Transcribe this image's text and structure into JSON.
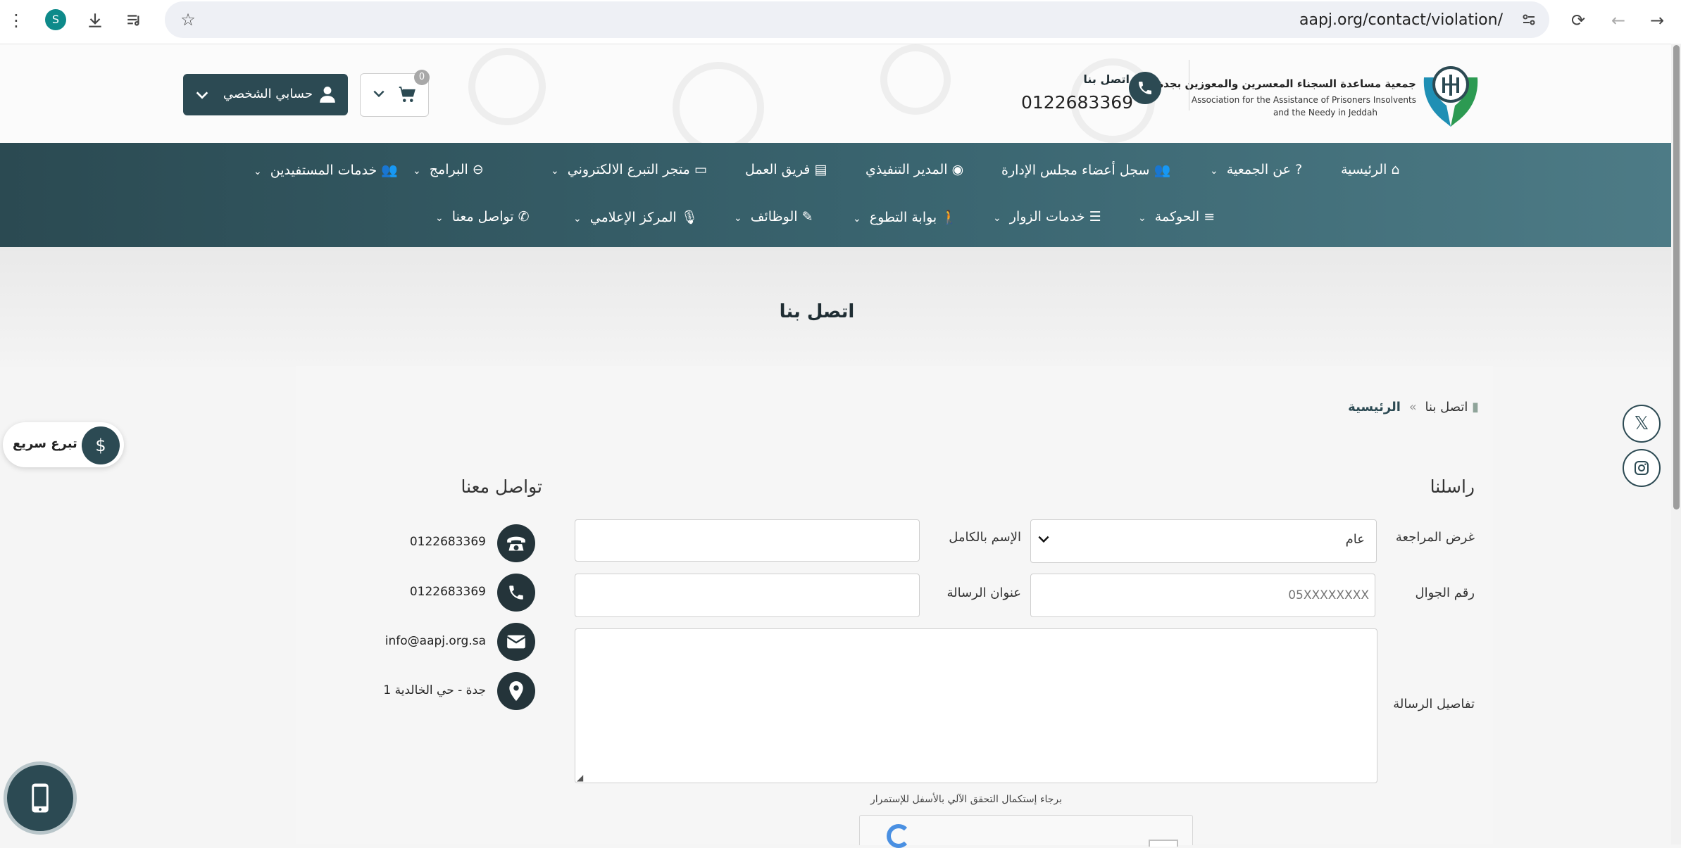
{
  "browser": {
    "url": "aapj.org/contact/violation/",
    "avatar_letter": "S"
  },
  "header": {
    "logo_ar": "جمعية مساعدة السجناء المعسرين والمعوزين بجدة",
    "logo_en_line1": "Association for the Assistance of Prisoners Insolvents",
    "logo_en_line2": "and the Needy in Jeddah",
    "contact_label": "اتصل بنا",
    "contact_phone": "0122683369",
    "cart_count": "0",
    "account_label": "حسابي الشخصي"
  },
  "nav": {
    "row1": [
      {
        "label": "الرئيسية",
        "icon": "home-icon",
        "dropdown": false
      },
      {
        "label": "عن الجمعية",
        "icon": "question-icon",
        "dropdown": true
      },
      {
        "label": "سجل أعضاء مجلس الإدارة",
        "icon": "users-icon",
        "dropdown": false
      },
      {
        "label": "المدير التنفيذي",
        "icon": "user-circle-icon",
        "dropdown": false
      },
      {
        "label": "فريق العمل",
        "icon": "id-card-icon",
        "dropdown": false
      },
      {
        "label": "متجر التبرع الالكتروني",
        "icon": "credit-card-icon",
        "dropdown": true
      },
      {
        "label": "البرامج",
        "icon": "arrow-circle-icon",
        "dropdown": true
      },
      {
        "label": "خدمات المستفيدين",
        "icon": "users-icon",
        "dropdown": true
      }
    ],
    "row2": [
      {
        "label": "الحوكمة",
        "icon": "bars-icon",
        "dropdown": true
      },
      {
        "label": "خدمات الزوار",
        "icon": "server-icon",
        "dropdown": true
      },
      {
        "label": "بوابة التطوع",
        "icon": "person-icon",
        "dropdown": true
      },
      {
        "label": "الوظائف",
        "icon": "edit-icon",
        "dropdown": true
      },
      {
        "label": "المركز الإعلامي",
        "icon": "microphone-icon",
        "dropdown": true
      },
      {
        "label": "تواصل معنا",
        "icon": "phone-icon",
        "dropdown": true
      }
    ]
  },
  "page": {
    "title": "اتصل بنا",
    "breadcrumb_home": "الرئيسية",
    "breadcrumb_sep": "»",
    "breadcrumb_current": "اتصل بنا"
  },
  "form": {
    "heading": "راسلنا",
    "purpose_label": "غرض المراجعة",
    "purpose_value": "عام",
    "fullname_label": "الإسم بالكامل",
    "fullname_value": "",
    "mobile_label": "رقم الجوال",
    "mobile_placeholder": "05XXXXXXXX",
    "subject_label": "عنوان الرسالة",
    "subject_value": "",
    "details_label": "تفاصيل الرسالة",
    "captcha_note": "برجاء إستكمال التحقق الآلي بالأسفل للإستمرار"
  },
  "contact": {
    "heading": "تواصل معنا",
    "items": [
      {
        "icon": "telephone-icon",
        "text": "0122683369"
      },
      {
        "icon": "phone-icon",
        "text": "0122683369"
      },
      {
        "icon": "envelope-icon",
        "text": "info@aapj.org.sa"
      },
      {
        "icon": "location-pin-icon",
        "text": "جدة - حي الخالدية 1"
      }
    ]
  },
  "widgets": {
    "quick_donate": "تبرع سريع"
  },
  "colors": {
    "primary": "#2c4a53",
    "nav_gradient_end": "#4d7b86"
  }
}
